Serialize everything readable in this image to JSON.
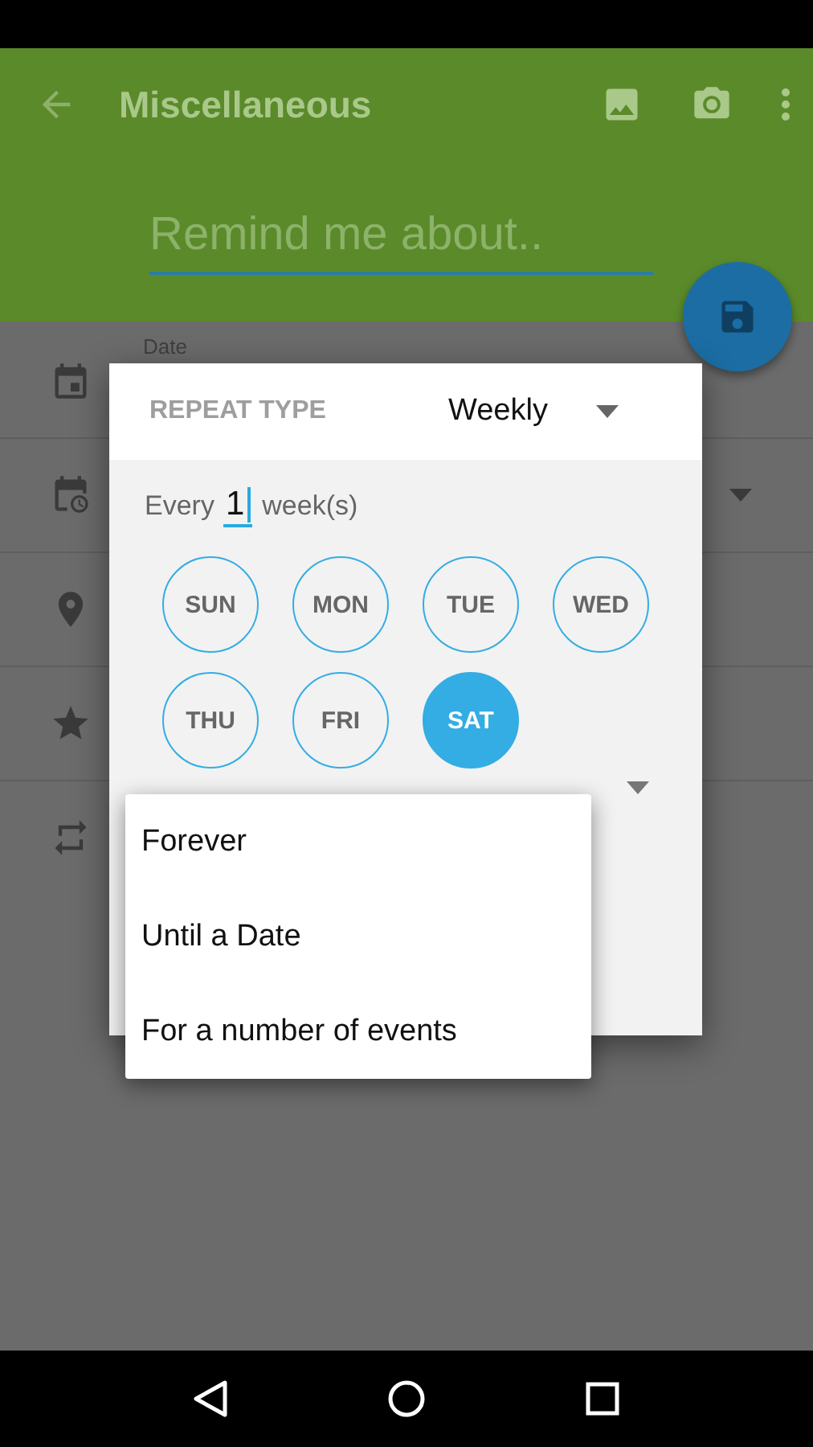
{
  "toolbar": {
    "title": "Miscellaneous",
    "placeholder": "Remind me about.."
  },
  "form": {
    "date_label": "Date"
  },
  "dialog": {
    "repeat_type_label": "REPEAT TYPE",
    "repeat_type_value": "Weekly",
    "every_prefix": "Every",
    "interval": "1",
    "unit": "week(s)",
    "days": [
      {
        "label": "SUN",
        "selected": false
      },
      {
        "label": "MON",
        "selected": false
      },
      {
        "label": "TUE",
        "selected": false
      },
      {
        "label": "WED",
        "selected": false
      },
      {
        "label": "THU",
        "selected": false
      },
      {
        "label": "FRI",
        "selected": false
      },
      {
        "label": "SAT",
        "selected": true
      }
    ],
    "end_options": [
      "Forever",
      "Until a Date",
      "For a number of events"
    ]
  }
}
